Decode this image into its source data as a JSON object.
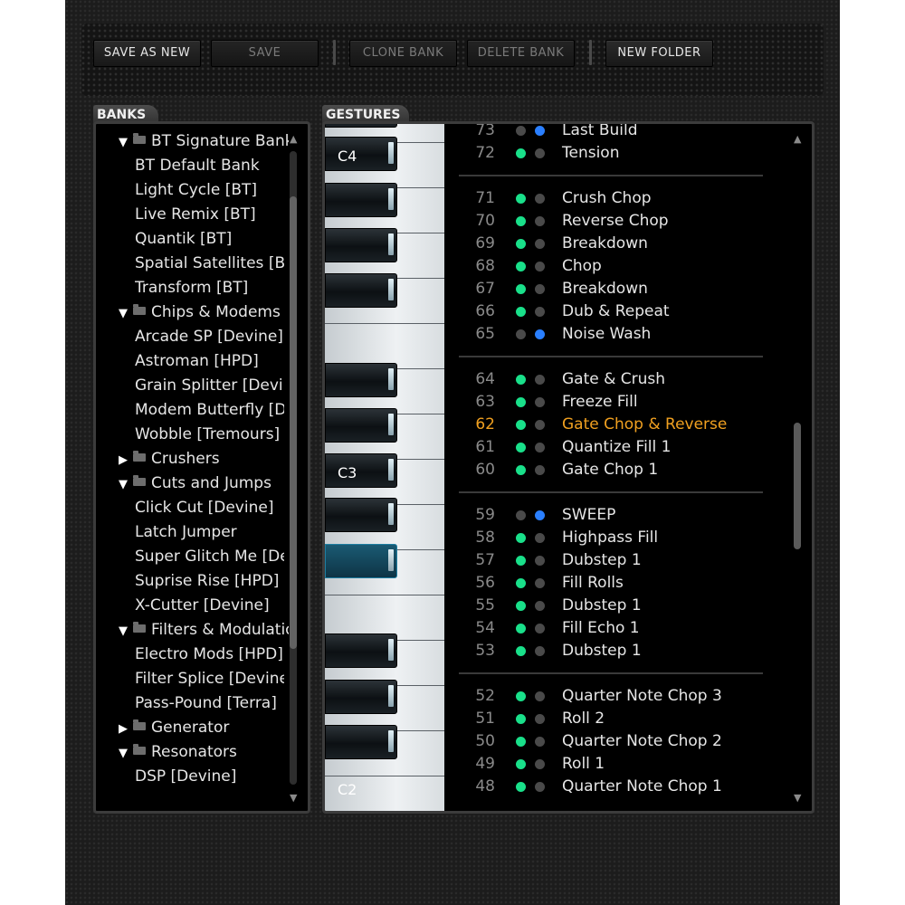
{
  "toolbar": {
    "save_as_new": "SAVE AS NEW",
    "save": "SAVE",
    "clone_bank": "CLONE BANK",
    "delete_bank": "DELETE BANK",
    "new_folder": "NEW FOLDER"
  },
  "banks": {
    "title": "BANKS",
    "items": [
      {
        "label": "BT Signature Banks",
        "kind": "folder",
        "expanded": true
      },
      {
        "label": "BT Default Bank",
        "kind": "bank"
      },
      {
        "label": "Light Cycle [BT]",
        "kind": "bank"
      },
      {
        "label": "Live Remix [BT]",
        "kind": "bank"
      },
      {
        "label": "Quantik [BT]",
        "kind": "bank"
      },
      {
        "label": "Spatial Satellites [BT]",
        "kind": "bank"
      },
      {
        "label": "Transform [BT]",
        "kind": "bank"
      },
      {
        "label": "Chips & Modems",
        "kind": "folder",
        "expanded": true
      },
      {
        "label": "Arcade SP [Devine]",
        "kind": "bank"
      },
      {
        "label": "Astroman [HPD]",
        "kind": "bank"
      },
      {
        "label": "Grain Splitter [Devine]",
        "kind": "bank"
      },
      {
        "label": "Modem Butterfly [Devine]",
        "kind": "bank"
      },
      {
        "label": "Wobble [Tremours]",
        "kind": "bank"
      },
      {
        "label": "Crushers",
        "kind": "folder",
        "expanded": false
      },
      {
        "label": "Cuts and Jumps",
        "kind": "folder",
        "expanded": true
      },
      {
        "label": "Click Cut [Devine]",
        "kind": "bank"
      },
      {
        "label": "Latch Jumper",
        "kind": "bank"
      },
      {
        "label": "Super Glitch Me [Devine]",
        "kind": "bank"
      },
      {
        "label": "Suprise Rise [HPD]",
        "kind": "bank"
      },
      {
        "label": "X-Cutter [Devine]",
        "kind": "bank"
      },
      {
        "label": "Filters & Modulation",
        "kind": "folder",
        "expanded": true
      },
      {
        "label": "Electro Mods [HPD]",
        "kind": "bank"
      },
      {
        "label": "Filter Splice [Devine]",
        "kind": "bank"
      },
      {
        "label": "Pass-Pound [Terra]",
        "kind": "bank"
      },
      {
        "label": "Generator",
        "kind": "folder",
        "expanded": false
      },
      {
        "label": "Resonators",
        "kind": "folder",
        "expanded": true
      },
      {
        "label": "DSP [Devine]",
        "kind": "bank"
      }
    ]
  },
  "gestures": {
    "title": "GESTURES",
    "octave_labels": [
      "C4",
      "C3",
      "C2"
    ],
    "selected_note": "62",
    "groups": [
      [
        {
          "num": "73",
          "name": "Last Build",
          "dot1": "grey",
          "dot2": "blue"
        },
        {
          "num": "72",
          "name": "Tension",
          "dot1": "green",
          "dot2": "grey"
        }
      ],
      [
        {
          "num": "71",
          "name": "Crush Chop",
          "dot1": "green",
          "dot2": "grey"
        },
        {
          "num": "70",
          "name": "Reverse Chop",
          "dot1": "green",
          "dot2": "grey"
        },
        {
          "num": "69",
          "name": "Breakdown",
          "dot1": "green",
          "dot2": "grey"
        },
        {
          "num": "68",
          "name": "Chop",
          "dot1": "green",
          "dot2": "grey"
        },
        {
          "num": "67",
          "name": "Breakdown",
          "dot1": "green",
          "dot2": "grey"
        },
        {
          "num": "66",
          "name": "Dub & Repeat",
          "dot1": "green",
          "dot2": "grey"
        },
        {
          "num": "65",
          "name": "Noise Wash",
          "dot1": "grey",
          "dot2": "blue"
        }
      ],
      [
        {
          "num": "64",
          "name": "Gate & Crush",
          "dot1": "green",
          "dot2": "grey"
        },
        {
          "num": "63",
          "name": "Freeze Fill",
          "dot1": "green",
          "dot2": "grey"
        },
        {
          "num": "62",
          "name": "Gate Chop & Reverse",
          "dot1": "green",
          "dot2": "grey",
          "selected": true
        },
        {
          "num": "61",
          "name": "Quantize Fill 1",
          "dot1": "green",
          "dot2": "grey"
        },
        {
          "num": "60",
          "name": "Gate Chop 1",
          "dot1": "green",
          "dot2": "grey"
        }
      ],
      [
        {
          "num": "59",
          "name": "SWEEP",
          "dot1": "grey",
          "dot2": "blue"
        },
        {
          "num": "58",
          "name": "Highpass Fill",
          "dot1": "green",
          "dot2": "grey"
        },
        {
          "num": "57",
          "name": "Dubstep 1",
          "dot1": "green",
          "dot2": "grey"
        },
        {
          "num": "56",
          "name": "Fill Rolls",
          "dot1": "green",
          "dot2": "grey"
        },
        {
          "num": "55",
          "name": "Dubstep 1",
          "dot1": "green",
          "dot2": "grey"
        },
        {
          "num": "54",
          "name": "Fill Echo 1",
          "dot1": "green",
          "dot2": "grey"
        },
        {
          "num": "53",
          "name": "Dubstep 1",
          "dot1": "green",
          "dot2": "grey"
        }
      ],
      [
        {
          "num": "52",
          "name": "Quarter Note Chop 3",
          "dot1": "green",
          "dot2": "grey"
        },
        {
          "num": "51",
          "name": "Roll 2",
          "dot1": "green",
          "dot2": "grey"
        },
        {
          "num": "50",
          "name": "Quarter Note Chop 2",
          "dot1": "green",
          "dot2": "grey"
        },
        {
          "num": "49",
          "name": "Roll 1",
          "dot1": "green",
          "dot2": "grey"
        },
        {
          "num": "48",
          "name": "Quarter Note Chop 1",
          "dot1": "green",
          "dot2": "grey"
        }
      ]
    ]
  },
  "colors": {
    "dot_green": "#19e08a",
    "dot_blue": "#2a7fff",
    "dot_grey": "#4a4a4a",
    "selected_text": "#f0a020"
  }
}
